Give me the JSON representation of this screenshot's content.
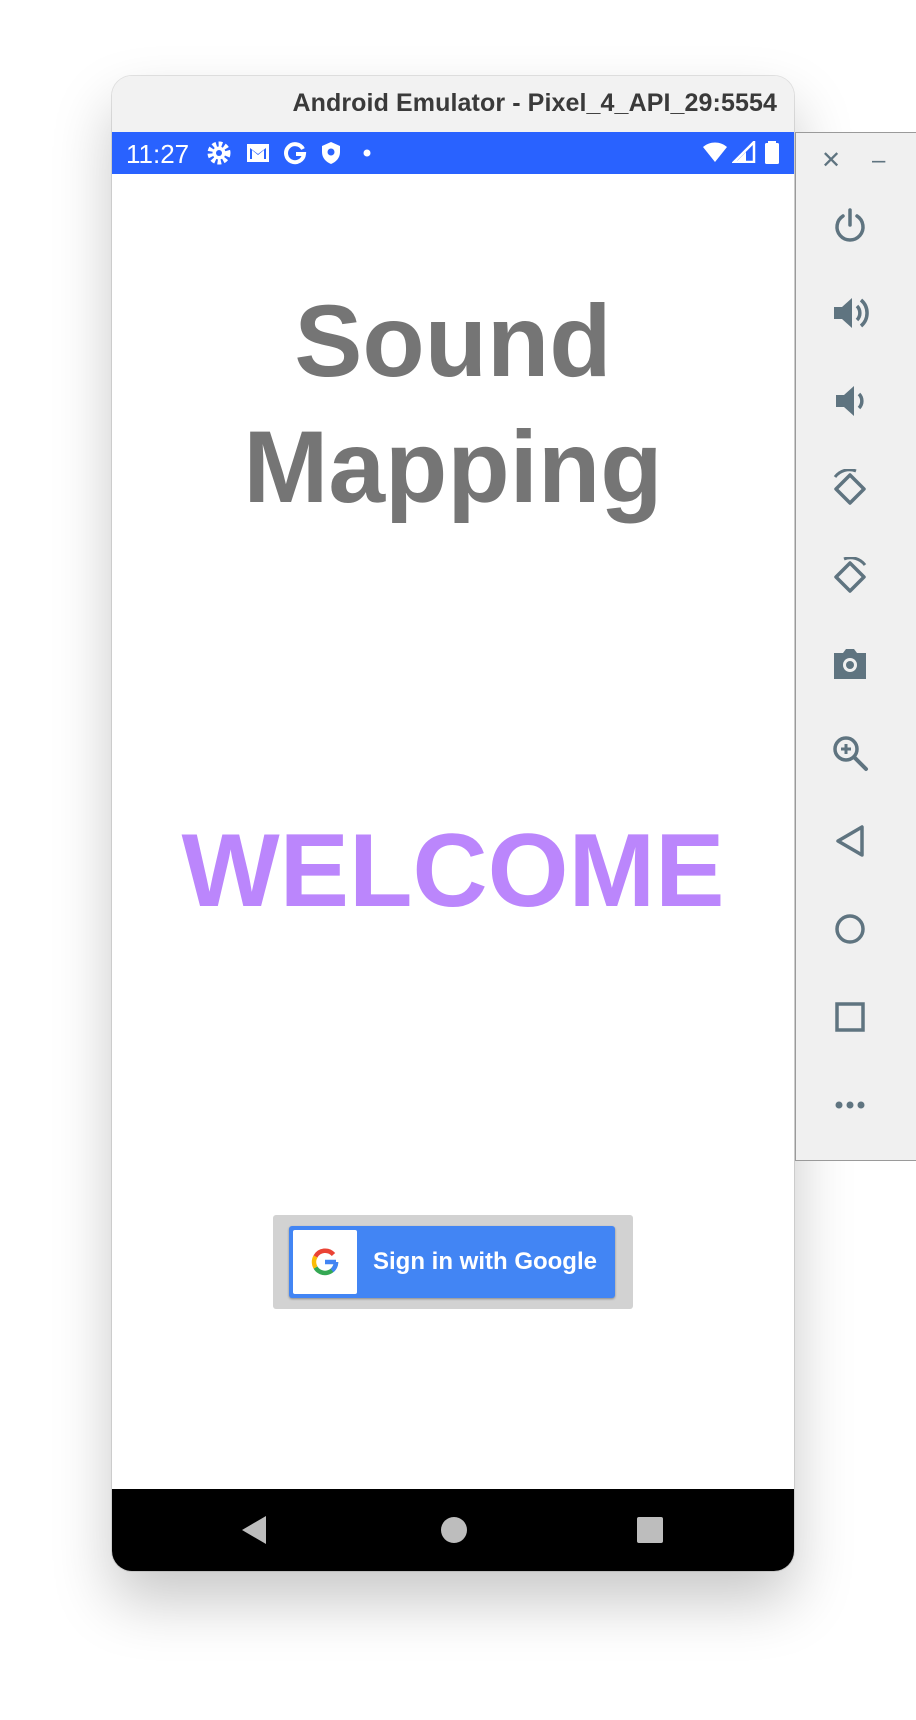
{
  "window": {
    "title": "Android Emulator - Pixel_4_API_29:5554"
  },
  "status_bar": {
    "time": "11:27",
    "left_icons": [
      "settings-icon",
      "gmail-icon",
      "google-icon",
      "shield-icon",
      "dot-icon"
    ],
    "right_icons": [
      "wifi-icon",
      "cellular-signal-icon",
      "battery-icon"
    ]
  },
  "app": {
    "title": "Sound Mapping",
    "welcome": "WELCOME",
    "signin_label": "Sign in with Google"
  },
  "nav_bar": {
    "buttons": [
      "back",
      "home",
      "recents"
    ]
  },
  "side_panel": {
    "top_controls": [
      "close",
      "minimize"
    ],
    "buttons": [
      "power",
      "volume-up",
      "volume-down",
      "rotate-left",
      "rotate-right",
      "screenshot",
      "zoom",
      "back",
      "home",
      "overview",
      "more"
    ]
  },
  "colors": {
    "status_bar": "#2962ff",
    "title_text": "#757575",
    "welcome_text": "#bb86fc",
    "signin_button": "#4285f4",
    "panel_icons": "#5f7480"
  }
}
